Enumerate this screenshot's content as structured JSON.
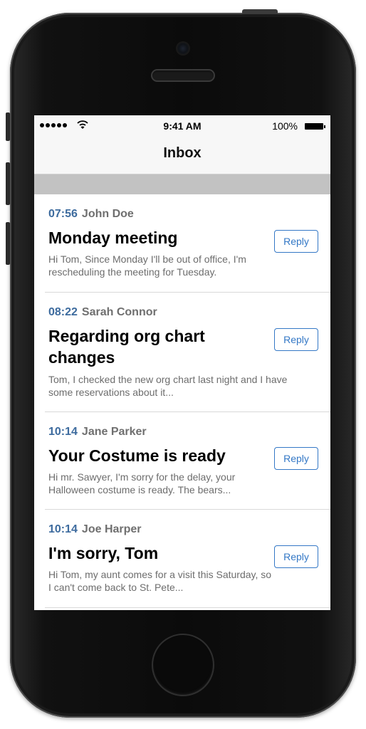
{
  "status_bar": {
    "time": "9:41 AM",
    "battery": "100%"
  },
  "nav": {
    "title": "Inbox"
  },
  "messages": [
    {
      "time": "07:56",
      "from": "John Doe",
      "subject": "Monday meeting",
      "preview": "Hi Tom, Since Monday I'll be out of office, I'm rescheduling the meeting for Tuesday.",
      "reply_label": "Reply"
    },
    {
      "time": "08:22",
      "from": "Sarah Connor",
      "subject": "Regarding org chart changes",
      "preview": "Tom, I checked the new org chart last night and I have some reservations about it...",
      "reply_label": "Reply"
    },
    {
      "time": "10:14",
      "from": "Jane Parker",
      "subject": "Your Costume is ready",
      "preview": "Hi mr. Sawyer, I'm sorry for the delay, your Halloween costume is ready. The bears...",
      "reply_label": "Reply"
    },
    {
      "time": "10:14",
      "from": "Joe Harper",
      "subject": "I'm sorry, Tom",
      "preview": "Hi Tom, my aunt comes for a visit this Saturday, so I can't come back to St. Pete...",
      "reply_label": "Reply"
    }
  ]
}
